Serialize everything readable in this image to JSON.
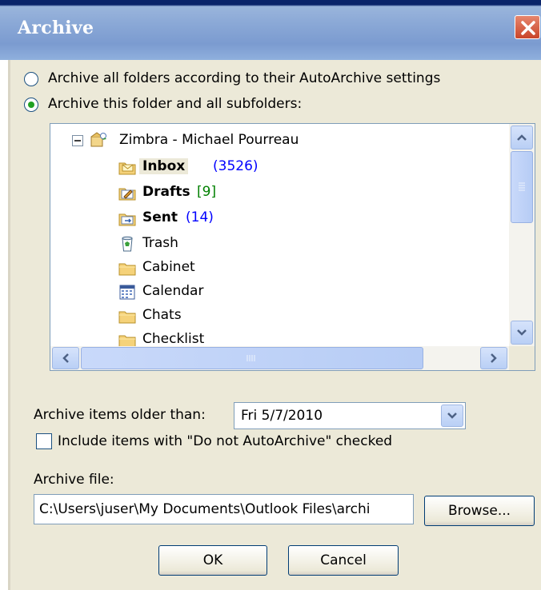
{
  "window": {
    "title": "Archive"
  },
  "options": {
    "all_folders": "Archive all folders according to their AutoArchive settings",
    "this_folder": "Archive this folder and all subfolders:",
    "selected": "this_folder"
  },
  "tree": {
    "root": "Zimbra - Michael Pourreau",
    "items": [
      {
        "label": "Inbox",
        "count": "(3526)",
        "bold": true,
        "icon": "inbox-icon",
        "count_color": "#0000ff"
      },
      {
        "label": "Drafts",
        "count": "[9]",
        "bold": true,
        "icon": "drafts-icon",
        "count_color": "#008000"
      },
      {
        "label": "Sent",
        "count": "(14)",
        "bold": true,
        "icon": "sent-icon",
        "count_color": "#0000ff"
      },
      {
        "label": "Trash",
        "count": "",
        "bold": false,
        "icon": "trash-icon"
      },
      {
        "label": "Cabinet",
        "count": "",
        "bold": false,
        "icon": "folder-icon"
      },
      {
        "label": "Calendar",
        "count": "",
        "bold": false,
        "icon": "calendar-icon"
      },
      {
        "label": "Chats",
        "count": "",
        "bold": false,
        "icon": "folder-icon"
      },
      {
        "label": "Checklist",
        "count": "",
        "bold": false,
        "icon": "folder-icon"
      }
    ]
  },
  "older_than": {
    "label": "Archive items older than:",
    "value": "Fri 5/7/2010"
  },
  "include_checkbox": {
    "label": "Include items with \"Do not AutoArchive\" checked",
    "checked": false
  },
  "archive_file": {
    "label": "Archive file:",
    "value": "C:\\Users\\juser\\My Documents\\Outlook Files\\archi"
  },
  "buttons": {
    "browse": "Browse...",
    "ok": "OK",
    "cancel": "Cancel"
  },
  "colors": {
    "title_bar": "#8aa8d6",
    "dialog_bg": "#ECE9D8",
    "close": "#c9452a",
    "radio_dot": "#21a121"
  }
}
